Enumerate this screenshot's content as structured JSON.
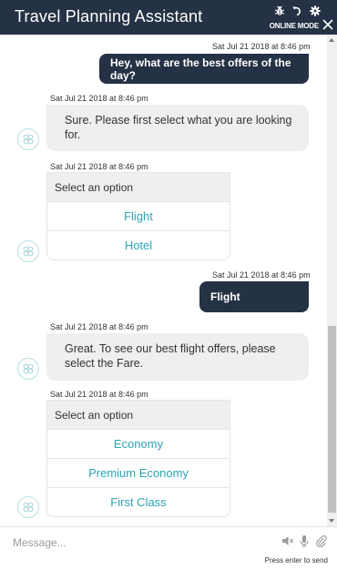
{
  "header": {
    "title": "Travel Planning Assistant",
    "mode": "ONLINE MODE",
    "icons": [
      "bug-icon",
      "refresh-icon",
      "gear-icon",
      "close-icon"
    ]
  },
  "messages": [
    {
      "timestamp": "Sat Jul 21 2018 at 8:46 pm",
      "text": "Hey, what are the best offers of the day?"
    },
    {
      "timestamp": "Sat Jul 21 2018 at 8:46 pm",
      "text": "Sure. Please first select what you are looking for."
    },
    {
      "timestamp": "Sat Jul 21 2018 at 8:46 pm",
      "header": "Select an option",
      "options": [
        "Flight",
        "Hotel"
      ]
    },
    {
      "timestamp": "Sat Jul 21 2018 at 8:46 pm",
      "text": "Flight"
    },
    {
      "timestamp": "Sat Jul 21 2018 at 8:46 pm",
      "text": "Great. To see our best flight offers, please select the Fare."
    },
    {
      "timestamp": "Sat Jul 21 2018 at 8:46 pm",
      "header": "Select an option",
      "options": [
        "Economy",
        "Premium Economy",
        "First Class"
      ]
    }
  ],
  "composer": {
    "placeholder": "Message...",
    "value": "",
    "hint": "Press enter to send",
    "icons": [
      "speaker-mute-icon",
      "microphone-icon",
      "attachment-icon"
    ]
  },
  "colors": {
    "header_bg": "#253144",
    "user_bubble_bg": "#253144",
    "bot_bubble_bg": "#efefef",
    "option_text": "#2ea3b5"
  }
}
